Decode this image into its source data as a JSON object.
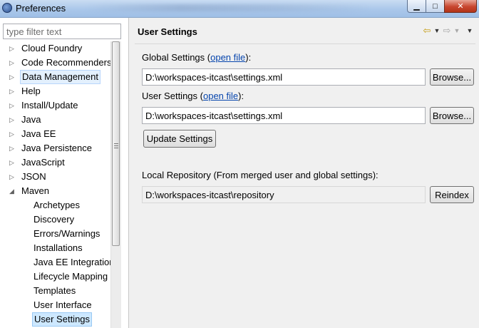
{
  "window": {
    "title": "Preferences"
  },
  "filter": {
    "placeholder": "type filter text"
  },
  "tree": [
    {
      "label": "Cloud Foundry"
    },
    {
      "label": "Code Recommenders"
    },
    {
      "label": "Data Management"
    },
    {
      "label": "Help"
    },
    {
      "label": "Install/Update"
    },
    {
      "label": "Java"
    },
    {
      "label": "Java EE"
    },
    {
      "label": "Java Persistence"
    },
    {
      "label": "JavaScript"
    },
    {
      "label": "JSON"
    },
    {
      "label": "Maven"
    },
    {
      "label": "Archetypes"
    },
    {
      "label": "Discovery"
    },
    {
      "label": "Errors/Warnings"
    },
    {
      "label": "Installations"
    },
    {
      "label": "Java EE Integration"
    },
    {
      "label": "Lifecycle Mapping"
    },
    {
      "label": "Templates"
    },
    {
      "label": "User Interface"
    },
    {
      "label": "User Settings"
    }
  ],
  "page": {
    "title": "User Settings",
    "global_label": "Global Settings (",
    "global_link": "open file",
    "global_suffix": "):",
    "global_value": "D:\\workspaces-itcast\\settings.xml",
    "browse": "Browse...",
    "user_label": "User Settings (",
    "user_link": "open file",
    "user_suffix": "):",
    "user_value": "D:\\workspaces-itcast\\settings.xml",
    "update": "Update Settings",
    "repo_label": "Local Repository (From merged user and global settings):",
    "repo_value": "D:\\workspaces-itcast\\repository",
    "reindex": "Reindex"
  },
  "icons": {
    "back": "back-arrow-icon",
    "forward": "forward-arrow-icon",
    "menu": "view-menu-icon"
  }
}
